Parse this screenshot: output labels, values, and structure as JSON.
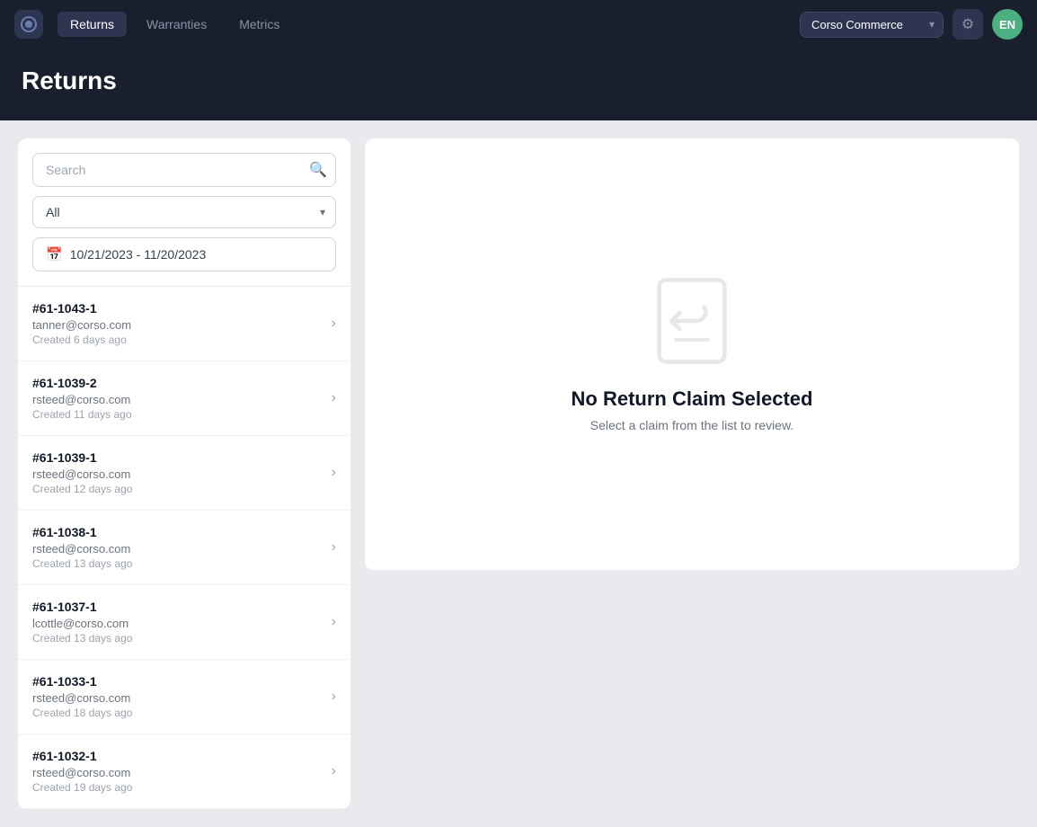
{
  "nav": {
    "items": [
      {
        "label": "Returns",
        "active": true
      },
      {
        "label": "Warranties",
        "active": false
      },
      {
        "label": "Metrics",
        "active": false
      }
    ],
    "store": "Corso Commerce",
    "avatar_initials": "EN"
  },
  "page": {
    "title": "Returns"
  },
  "filters": {
    "search_placeholder": "Search",
    "status_options": [
      "All"
    ],
    "selected_status": "All",
    "date_range": "10/21/2023 - 11/20/2023"
  },
  "claims": [
    {
      "id": "#61-1043-1",
      "email": "tanner@corso.com",
      "created": "Created 6 days ago"
    },
    {
      "id": "#61-1039-2",
      "email": "rsteed@corso.com",
      "created": "Created 11 days ago"
    },
    {
      "id": "#61-1039-1",
      "email": "rsteed@corso.com",
      "created": "Created 12 days ago"
    },
    {
      "id": "#61-1038-1",
      "email": "rsteed@corso.com",
      "created": "Created 13 days ago"
    },
    {
      "id": "#61-1037-1",
      "email": "lcottle@corso.com",
      "created": "Created 13 days ago"
    },
    {
      "id": "#61-1033-1",
      "email": "rsteed@corso.com",
      "created": "Created 18 days ago"
    },
    {
      "id": "#61-1032-1",
      "email": "rsteed@corso.com",
      "created": "Created 19 days ago"
    }
  ],
  "empty_state": {
    "title": "No Return Claim Selected",
    "subtitle": "Select a claim from the list to review."
  }
}
